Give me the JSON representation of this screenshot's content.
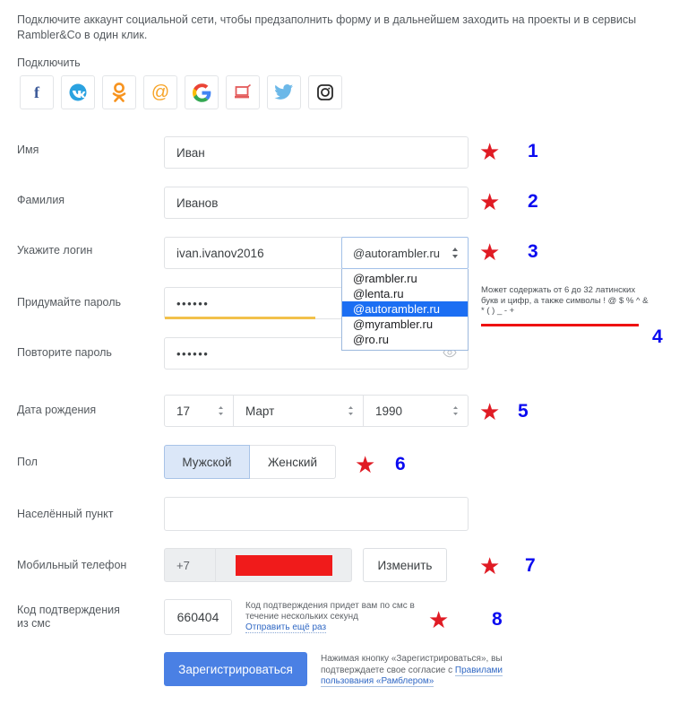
{
  "intro": {
    "text": "Подключите аккаунт социальной сети, чтобы предзаполнить форму и в дальнейшем заходить на проекты и в сервисы Rambler&Co в один клик.",
    "connect_label": "Подключить"
  },
  "social": {
    "items": [
      {
        "name": "facebook-icon",
        "title": "Facebook"
      },
      {
        "name": "vk-icon",
        "title": "ВКонтакте"
      },
      {
        "name": "odnoklassniki-icon",
        "title": "Одноклассники"
      },
      {
        "name": "mailru-icon",
        "title": "Mail.ru"
      },
      {
        "name": "google-icon",
        "title": "Google"
      },
      {
        "name": "rambler-icon",
        "title": "Rambler"
      },
      {
        "name": "twitter-icon",
        "title": "Twitter"
      },
      {
        "name": "instagram-icon",
        "title": "Instagram"
      }
    ]
  },
  "form": {
    "first_name": {
      "label": "Имя",
      "value": "Иван"
    },
    "last_name": {
      "label": "Фамилия",
      "value": "Иванов"
    },
    "login": {
      "label": "Укажите логин",
      "value": "ivan.ivanov2016",
      "selected_domain": "@autorambler.ru",
      "options": [
        "@rambler.ru",
        "@lenta.ru",
        "@autorambler.ru",
        "@myrambler.ru",
        "@ro.ru"
      ],
      "hint": "Может содержать от 6 до 32 латинских букв и цифр, а также символы ! @ $ % ^ & * ( ) _ - +"
    },
    "password": {
      "label": "Придумайте пароль",
      "value": "••••••",
      "strength_percent": 49
    },
    "password_repeat": {
      "label": "Повторите пароль",
      "value": "••••••",
      "reveal_icon": "eye-icon"
    },
    "birth_date": {
      "label": "Дата рождения",
      "day": "17",
      "month": "Март",
      "year": "1990"
    },
    "gender": {
      "label": "Пол",
      "male": "Мужской",
      "female": "Женский",
      "selected": "Мужской"
    },
    "city": {
      "label": "Населённый пункт",
      "value": ""
    },
    "phone": {
      "label": "Мобильный телефон",
      "country_code": "+7",
      "number": "",
      "change_button": "Изменить"
    },
    "sms_code": {
      "label": "Код подтверждения\nиз смс",
      "value": "660404",
      "hint": "Код подтверждения придет вам по смс в течение нескольких секунд",
      "resend_link": "Отправить ещё раз"
    }
  },
  "submit": {
    "button_label": "Зарегистрироваться",
    "terms_prefix": "Нажимая кнопку «Зарегистрироваться», вы подтверждаете свое согласие с ",
    "terms_link": "Правилами пользования «Рамблером»"
  },
  "annotations": {
    "star_glyph": "★",
    "items": [
      {
        "number": "1",
        "target": "first-name"
      },
      {
        "number": "2",
        "target": "last-name"
      },
      {
        "number": "3",
        "target": "login-domain"
      },
      {
        "number": "4",
        "target": "login-hint"
      },
      {
        "number": "5",
        "target": "birth-date"
      },
      {
        "number": "6",
        "target": "gender"
      },
      {
        "number": "7",
        "target": "phone"
      },
      {
        "number": "8",
        "target": "sms-code"
      }
    ]
  },
  "colors": {
    "accent_blue": "#4a80e4",
    "annotation_star": "#e01b24",
    "annotation_number": "#0b0bf0",
    "strength_bar": "#f2c14b",
    "redaction": "#f01b1b",
    "dropdown_selected": "#1b6ef3"
  }
}
